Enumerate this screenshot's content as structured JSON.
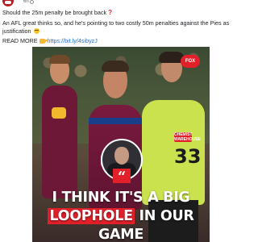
{
  "post": {
    "time": "6h",
    "line1": "Should the 25m penalty be brought back",
    "line2": "An AFL great thinks so, and he's pointing to two costly 50m penalties against the Pies as",
    "line3": "justification",
    "read_more_label": "READ MORE",
    "link": "https://bit.ly/4sibyzJ"
  },
  "image": {
    "broadcaster_logo": "FOX",
    "jersey_number": "33",
    "sponsor_text": "CHEMIST WAREHOUSE",
    "quote_mark": "“",
    "headline_line1": "I THINK IT'S A BIG",
    "headline_highlight": "LOOPHOLE",
    "headline_line2_rest": " IN OUR",
    "headline_line3": "GAME"
  },
  "colors": {
    "accent_red": "#e2202a",
    "link_blue": "#1b74e4",
    "umpire_green": "#c9e24d",
    "maroon": "#6d1837"
  },
  "icons": [
    "globe-icon",
    "exclamation-icon",
    "emoji-icon",
    "pointing-hand-icon",
    "quote-icon"
  ]
}
